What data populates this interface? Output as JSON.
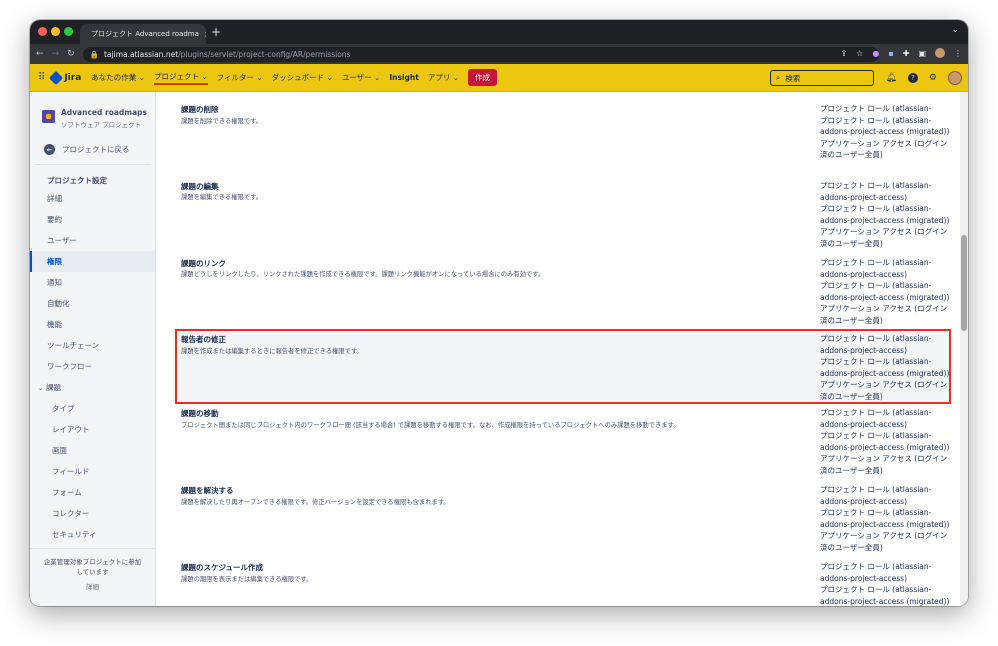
{
  "browser": {
    "tab_title": "プロジェクト Advanced roadma",
    "url_host": "tajima.atlassian.net",
    "url_path": "/plugins/servlet/project-config/AR/permissions",
    "new_tab": "+",
    "close": "×"
  },
  "jira": {
    "logo": "Jira",
    "nav": [
      {
        "label": "あなたの作業 ⌄"
      },
      {
        "label": "プロジェクト ⌄"
      },
      {
        "label": "フィルター ⌄"
      },
      {
        "label": "ダッシュボード ⌄"
      },
      {
        "label": "ユーザー ⌄"
      },
      {
        "label": "Insight"
      },
      {
        "label": "アプリ ⌄"
      }
    ],
    "create": "作成",
    "search_placeholder": "検索"
  },
  "sidebar": {
    "project_name": "Advanced roadmaps",
    "project_type": "ソフトウェア プロジェクト",
    "back": "プロジェクトに戻る",
    "section": "プロジェクト設定",
    "items": [
      "詳細",
      "要約",
      "ユーザー",
      "権限",
      "通知",
      "自動化",
      "機能",
      "ツールチェーン",
      "ワークフロー",
      "課題"
    ],
    "subitems": [
      "タイプ",
      "レイアウト",
      "画面",
      "フィールド",
      "フォーム",
      "コレクター",
      "セキュリティ"
    ],
    "footer": "企業管理対象プロジェクトに参加しています",
    "footer_link": "詳細"
  },
  "permissions": [
    {
      "title": "課題の削除",
      "desc": "課題を削除できる権限です。"
    },
    {
      "title": "課題の編集",
      "desc": "課題を編集できる権限です。"
    },
    {
      "title": "課題のリンク",
      "desc": "課題どうしをリンクしたり、リンクされた課題を作成できる権限です。課題リンク機能がオンになっている場合にのみ有効です。"
    },
    {
      "title": "報告者の修正",
      "desc": "課題を作成または編集するときに報告者を修正できる権限です。"
    },
    {
      "title": "課題の移動",
      "desc": "プロジェクト間または同じプロジェクト内のワークフロー間 (該当する場合) で課題を移動する権限です。なお、作成権限を持っているプロジェクトへのみ課題を移動できます。"
    },
    {
      "title": "課題を解決する",
      "desc": "課題を解決したり再オープンできる権限です。修正バージョンを設定できる権限も含まれます。"
    },
    {
      "title": "課題のスケジュール作成",
      "desc": "課題の期限を表示または編集できる権限です。"
    }
  ],
  "roles": {
    "r1a": "プロジェクト ロール (atlassian-",
    "r1b": "addons-project-access)",
    "r2a": "プロジェクト ロール (atlassian-",
    "r2b": "addons-project-access (migrated))",
    "r3a": "アプリケーション アクセス (ログイン",
    "r3b": "済のユーザー全員)"
  },
  "colors": {
    "jira_bar": "#ecc60f",
    "create": "#c9143a",
    "highlight_border": "#e0341f",
    "active_nav": "#0052cc"
  }
}
